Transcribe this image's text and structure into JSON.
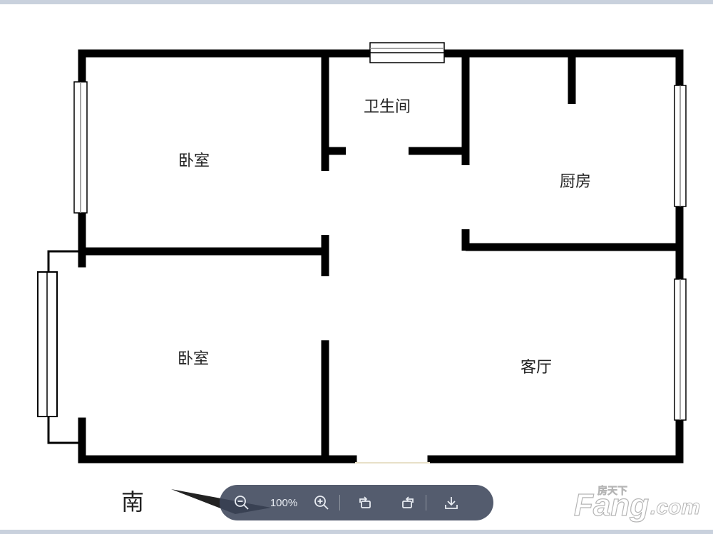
{
  "rooms": {
    "bedroom_north": "卧室",
    "bathroom": "卫生间",
    "kitchen": "厨房",
    "bedroom_south": "卧室",
    "living_room": "客厅"
  },
  "compass": {
    "label": "南"
  },
  "viewer_toolbar": {
    "zoom_level": "100%",
    "zoom_out_icon": "zoom-out-icon",
    "zoom_in_icon": "zoom-in-icon",
    "rotate_left_icon": "rotate-left-icon",
    "rotate_right_icon": "rotate-right-icon",
    "download_icon": "download-icon"
  },
  "watermark": {
    "brand": "Fang.com",
    "chinese": "房天下"
  },
  "colors": {
    "wall": "#000000",
    "toolbar_bg": "#3c465a",
    "frame_bar": "#c9d1dd"
  }
}
